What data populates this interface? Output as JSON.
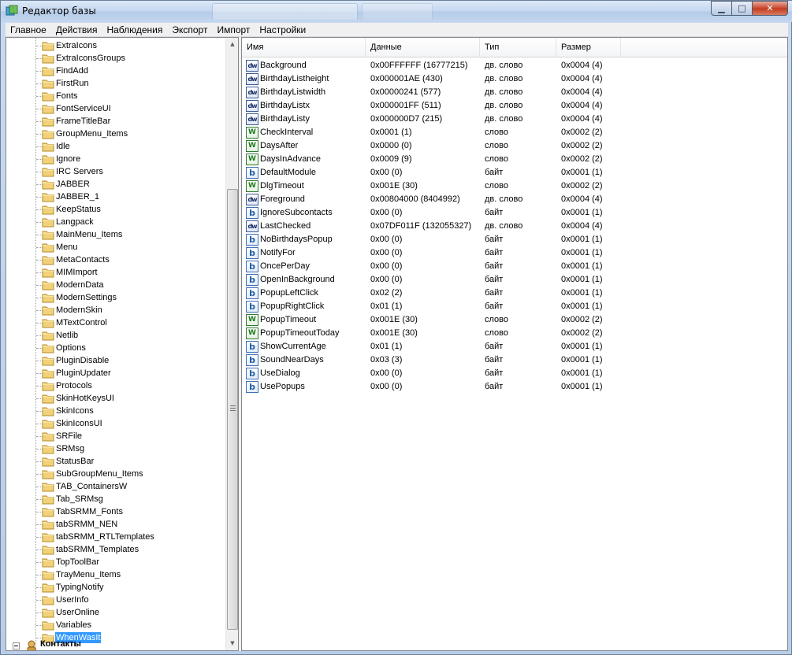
{
  "window": {
    "title": "Редактор базы"
  },
  "menu": [
    "Главное",
    "Действия",
    "Наблюдения",
    "Экспорт",
    "Импорт",
    "Настройки"
  ],
  "tree": {
    "items": [
      "ExtraIcons",
      "ExtraIconsGroups",
      "FindAdd",
      "FirstRun",
      "Fonts",
      "FontServiceUI",
      "FrameTitleBar",
      "GroupMenu_Items",
      "Idle",
      "Ignore",
      "IRC Servers",
      "JABBER",
      "JABBER_1",
      "KeepStatus",
      "Langpack",
      "MainMenu_Items",
      "Menu",
      "MetaContacts",
      "MIMImport",
      "ModernData",
      "ModernSettings",
      "ModernSkin",
      "MTextControl",
      "Netlib",
      "Options",
      "PluginDisable",
      "PluginUpdater",
      "Protocols",
      "SkinHotKeysUI",
      "SkinIcons",
      "SkinIconsUI",
      "SRFile",
      "SRMsg",
      "StatusBar",
      "SubGroupMenu_Items",
      "TAB_ContainersW",
      "Tab_SRMsg",
      "TabSRMM_Fonts",
      "tabSRMM_NEN",
      "tabSRMM_RTLTemplates",
      "tabSRMM_Templates",
      "TopToolBar",
      "TrayMenu_Items",
      "TypingNotify",
      "UserInfo",
      "UserOnline",
      "Variables",
      "WhenWasIt"
    ],
    "selected": "WhenWasIt",
    "partial_next": "Контакты"
  },
  "list": {
    "columns": [
      "Имя",
      "Данные",
      "Тип",
      "Размер"
    ],
    "rows": [
      {
        "icon": "dword",
        "name": "Background",
        "data": "0x00FFFFFF (16777215)",
        "type": "дв. слово",
        "size": "0x0004 (4)"
      },
      {
        "icon": "dword",
        "name": "BirthdayListheight",
        "data": "0x000001AE (430)",
        "type": "дв. слово",
        "size": "0x0004 (4)"
      },
      {
        "icon": "dword",
        "name": "BirthdayListwidth",
        "data": "0x00000241 (577)",
        "type": "дв. слово",
        "size": "0x0004 (4)"
      },
      {
        "icon": "dword",
        "name": "BirthdayListx",
        "data": "0x000001FF (511)",
        "type": "дв. слово",
        "size": "0x0004 (4)"
      },
      {
        "icon": "dword",
        "name": "BirthdayListy",
        "data": "0x000000D7 (215)",
        "type": "дв. слово",
        "size": "0x0004 (4)"
      },
      {
        "icon": "word",
        "name": "CheckInterval",
        "data": "0x0001 (1)",
        "type": "слово",
        "size": "0x0002 (2)"
      },
      {
        "icon": "word",
        "name": "DaysAfter",
        "data": "0x0000 (0)",
        "type": "слово",
        "size": "0x0002 (2)"
      },
      {
        "icon": "word",
        "name": "DaysInAdvance",
        "data": "0x0009 (9)",
        "type": "слово",
        "size": "0x0002 (2)"
      },
      {
        "icon": "byte",
        "name": "DefaultModule",
        "data": "0x00 (0)",
        "type": "байт",
        "size": "0x0001 (1)"
      },
      {
        "icon": "word",
        "name": "DlgTimeout",
        "data": "0x001E (30)",
        "type": "слово",
        "size": "0x0002 (2)"
      },
      {
        "icon": "dword",
        "name": "Foreground",
        "data": "0x00804000 (8404992)",
        "type": "дв. слово",
        "size": "0x0004 (4)"
      },
      {
        "icon": "byte",
        "name": "IgnoreSubcontacts",
        "data": "0x00 (0)",
        "type": "байт",
        "size": "0x0001 (1)"
      },
      {
        "icon": "dword",
        "name": "LastChecked",
        "data": "0x07DF011F (132055327)",
        "type": "дв. слово",
        "size": "0x0004 (4)"
      },
      {
        "icon": "byte",
        "name": "NoBirthdaysPopup",
        "data": "0x00 (0)",
        "type": "байт",
        "size": "0x0001 (1)"
      },
      {
        "icon": "byte",
        "name": "NotifyFor",
        "data": "0x00 (0)",
        "type": "байт",
        "size": "0x0001 (1)"
      },
      {
        "icon": "byte",
        "name": "OncePerDay",
        "data": "0x00 (0)",
        "type": "байт",
        "size": "0x0001 (1)"
      },
      {
        "icon": "byte",
        "name": "OpenInBackground",
        "data": "0x00 (0)",
        "type": "байт",
        "size": "0x0001 (1)"
      },
      {
        "icon": "byte",
        "name": "PopupLeftClick",
        "data": "0x02 (2)",
        "type": "байт",
        "size": "0x0001 (1)"
      },
      {
        "icon": "byte",
        "name": "PopupRightClick",
        "data": "0x01 (1)",
        "type": "байт",
        "size": "0x0001 (1)"
      },
      {
        "icon": "word",
        "name": "PopupTimeout",
        "data": "0x001E (30)",
        "type": "слово",
        "size": "0x0002 (2)"
      },
      {
        "icon": "word",
        "name": "PopupTimeoutToday",
        "data": "0x001E (30)",
        "type": "слово",
        "size": "0x0002 (2)"
      },
      {
        "icon": "byte",
        "name": "ShowCurrentAge",
        "data": "0x01 (1)",
        "type": "байт",
        "size": "0x0001 (1)"
      },
      {
        "icon": "byte",
        "name": "SoundNearDays",
        "data": "0x03 (3)",
        "type": "байт",
        "size": "0x0001 (1)"
      },
      {
        "icon": "byte",
        "name": "UseDialog",
        "data": "0x00 (0)",
        "type": "байт",
        "size": "0x0001 (1)"
      },
      {
        "icon": "byte",
        "name": "UsePopups",
        "data": "0x00 (0)",
        "type": "байт",
        "size": "0x0001 (1)"
      }
    ]
  },
  "icon_glyphs": {
    "dword": "dw",
    "word": "W",
    "byte": "b"
  },
  "colors": {
    "selection": "#3399ff",
    "folder": "#e8c468",
    "close_button": "#c13a1f"
  }
}
